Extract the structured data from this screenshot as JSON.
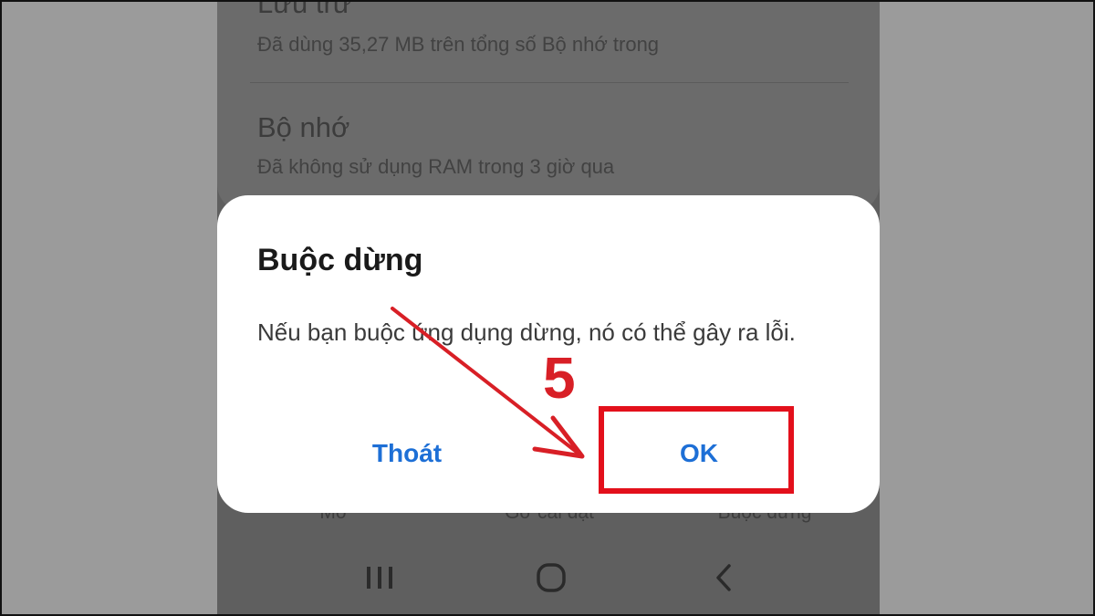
{
  "background": {
    "settings": [
      {
        "title": "Lưu trữ",
        "subtitle": "Đã dùng 35,27 MB trên tổng số Bộ nhớ trong"
      },
      {
        "title": "Bộ nhớ",
        "subtitle": "Đã không sử dụng RAM trong 3 giờ qua"
      }
    ],
    "bottom_actions": [
      "Mở",
      "Gỡ cài đặt",
      "Buộc dừng"
    ]
  },
  "dialog": {
    "title": "Buộc dừng",
    "message": "Nếu bạn buộc ứng dụng dừng, nó có thể gây ra lỗi.",
    "cancel_label": "Thoát",
    "ok_label": "OK"
  },
  "annotation": {
    "step": "5",
    "color": "#e3101b"
  },
  "navbar": {
    "icons": [
      "recents-icon",
      "home-icon",
      "back-icon"
    ]
  },
  "colors": {
    "button_text": "#1d6fd6",
    "overlay": "#5f5f5f"
  }
}
